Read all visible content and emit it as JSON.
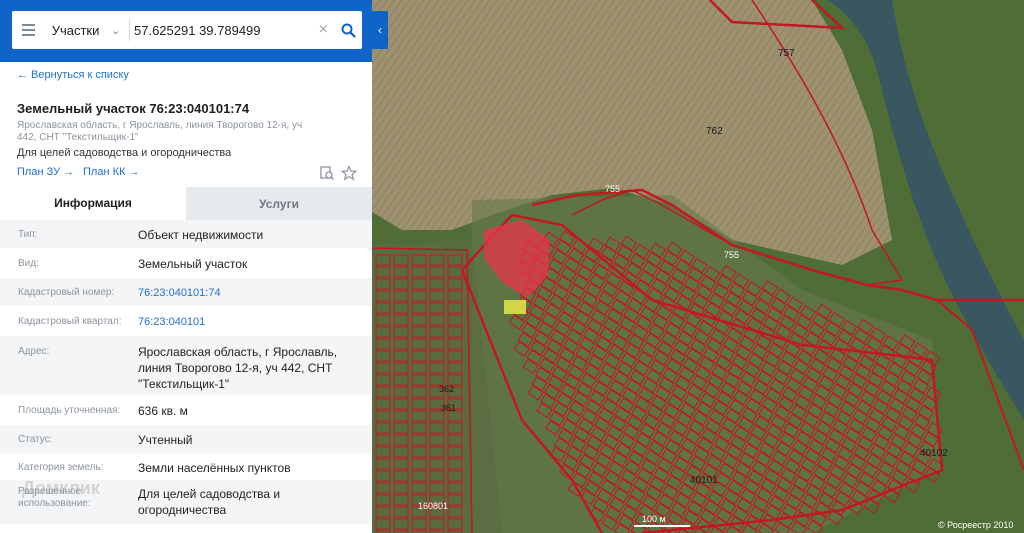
{
  "search": {
    "select_label": "Участки",
    "query": "57.625291 39.789499"
  },
  "details": {
    "back_label": "← Вернуться к списку",
    "title": "Земельный участок 76:23:040101:74",
    "address": "Ярославская область, г Ярославль, линия Творогово 12-я, уч 442, СНТ \"Текстильщик-1\"",
    "purpose": "Для целей садоводства и огородничества",
    "plan_zu": "План ЗУ →",
    "plan_kk": "План КК →"
  },
  "tabs": {
    "info": "Информация",
    "services": "Услуги"
  },
  "rows": [
    {
      "label": "Тип:",
      "value": "Объект недвижимости"
    },
    {
      "label": "Вид:",
      "value": "Земельный участок"
    },
    {
      "label": "Кадастровый номер:",
      "value": "76:23:040101:74"
    },
    {
      "label": "Кадастровый квартал:",
      "value": "76:23:040101"
    },
    {
      "label": "Адрес:",
      "value": "Ярославская область, г Ярославль, линия Творогово 12-я, уч 442, СНТ \"Текстильщик-1\""
    },
    {
      "label": "Площадь уточненная:",
      "value": "636 кв. м"
    },
    {
      "label": "Статус:",
      "value": "Учтенный"
    },
    {
      "label": "Категория земель:",
      "value": "Земли населённых пунктов"
    },
    {
      "label": "Разрешенное использование:",
      "value": "Для целей садоводства и огородничества"
    }
  ],
  "watermark": "Домклик",
  "map": {
    "labels": {
      "l757": "757",
      "l762": "762",
      "l755a": "755",
      "l755b": "755",
      "l40102": "40102",
      "l40101": "40101",
      "l160801": "160801",
      "l362": "362",
      "l361": "361"
    },
    "scale": "100 м",
    "copyright": "© Росреестр 2010"
  },
  "colors": {
    "brand_blue": "#0f64c7",
    "link_blue": "#1f6fd1",
    "parcel_red": "#c4171f",
    "highlight": "#e8344a"
  }
}
